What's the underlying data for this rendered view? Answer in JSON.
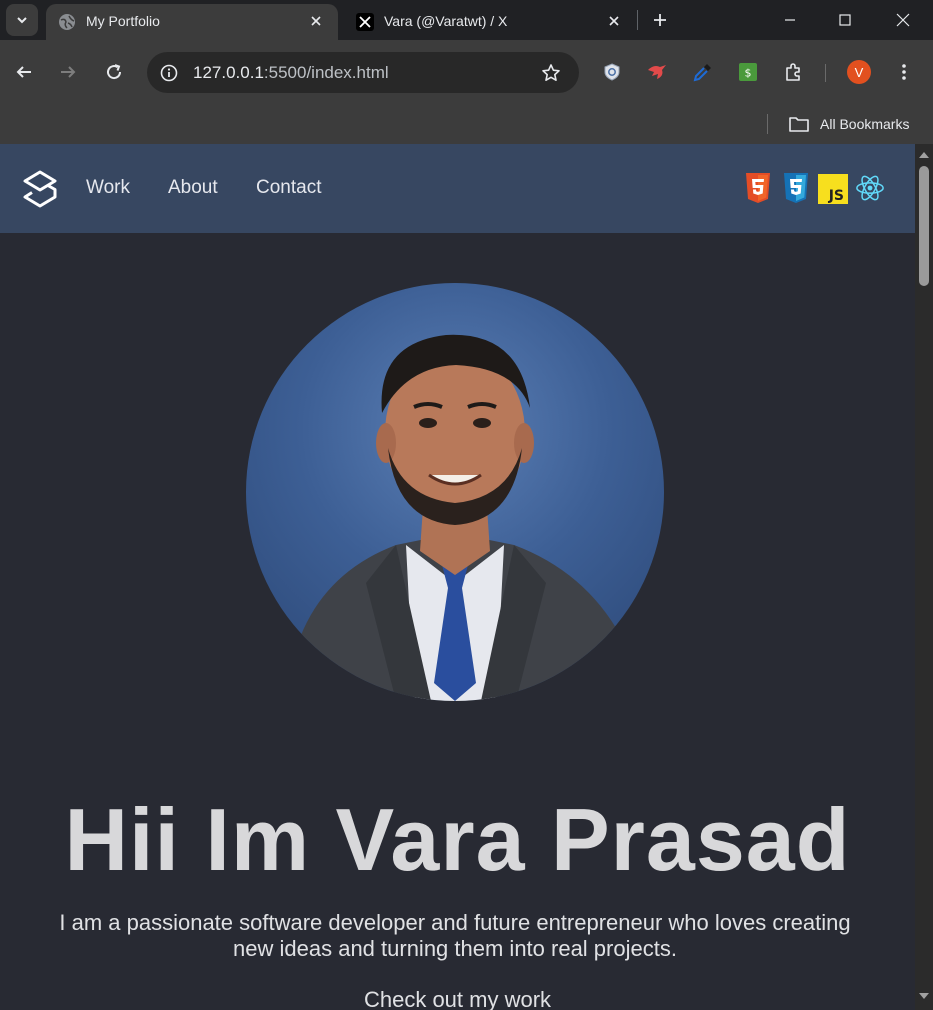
{
  "browser": {
    "tabs": [
      {
        "title": "My Portfolio",
        "active": true,
        "favicon": "globe-icon"
      },
      {
        "title": "Vara (@Varatwt) / X",
        "active": false,
        "favicon": "x-logo-icon"
      }
    ],
    "address_bar": {
      "url_host": "127.0.0.1",
      "url_rest": ":5500/index.html"
    },
    "extensions": [
      "shield-extension-icon",
      "red-bird-extension-icon",
      "eyedropper-extension-icon",
      "green-dollar-extension-icon",
      "puzzle-extensions-icon"
    ],
    "profile_initial": "V",
    "bookmarks": {
      "all_label": "All Bookmarks"
    }
  },
  "site": {
    "nav": {
      "links": [
        "Work",
        "About",
        "Contact"
      ]
    },
    "tech_icons": [
      "html5-icon",
      "css3-icon",
      "javascript-icon",
      "react-icon"
    ],
    "hero": {
      "title": "Hii Im Vara Prasad",
      "description": "I am a passionate software developer and future entrepreneur who loves creating new ideas and turning them into real projects.",
      "cta": "Check out my work"
    }
  },
  "colors": {
    "site_nav_bg": "#374761",
    "page_bg": "#282a33",
    "html5": "#e44d26",
    "css3": "#1572b6",
    "javascript": "#f7df1e",
    "react": "#61dafb",
    "profile": "#e2501f"
  }
}
